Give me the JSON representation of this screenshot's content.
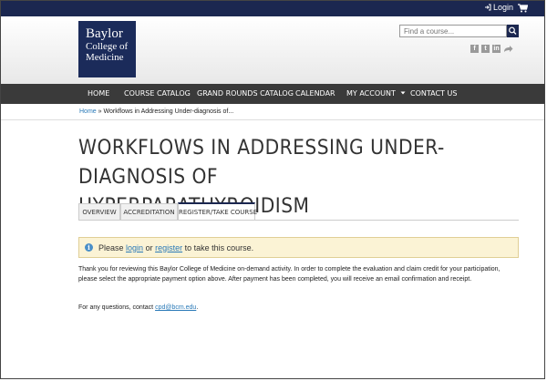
{
  "topbar": {
    "login_label": "Login",
    "login_icon": "login-arrow-icon",
    "cart_icon": "shopping-cart-icon",
    "bg_color": "#1b2750"
  },
  "header": {
    "logo": {
      "line1": "Baylor",
      "line2": "College of",
      "line3": "Medicine"
    },
    "search": {
      "placeholder": "Find a course...",
      "button_icon": "search-icon"
    },
    "social_icons": [
      "facebook-icon",
      "twitter-icon",
      "linkedin-icon",
      "share-icon"
    ]
  },
  "nav": {
    "items": [
      {
        "label": "HOME"
      },
      {
        "label": "COURSE CATALOG"
      },
      {
        "label": "GRAND ROUNDS CATALOG"
      },
      {
        "label": "CALENDAR"
      },
      {
        "label": "MY ACCOUNT"
      },
      {
        "label": "CONTACT US"
      }
    ],
    "dropdown_icon": "chevron-down-icon"
  },
  "breadcrumb": {
    "home": "Home",
    "separator": "»",
    "current": "Workflows in Addressing Under-diagnosis of..."
  },
  "page": {
    "title_line1": "WORKFLOWS IN ADDRESSING UNDER-DIAGNOSIS OF",
    "title_line2": "HYPERPARATHYROIDISM"
  },
  "tabs": [
    {
      "label": "OVERVIEW",
      "active": false
    },
    {
      "label": "ACCREDITATION",
      "active": false
    },
    {
      "label": "REGISTER/TAKE COURSE",
      "active": true
    }
  ],
  "alert": {
    "prefix": "Please",
    "login_link": "login",
    "or": "or",
    "register_link": "register",
    "suffix": "to take this course."
  },
  "body": {
    "paragraph1": "Thank you for reviewing this Baylor College of Medicine on-demand activity. In order to complete the evaluation and claim credit for your participation, please select the appropriate payment option above. After payment has been completed, you will receive an email confirmation and receipt.",
    "contact_prefix": "For any questions, contact",
    "contact_email": "cpd@bcm.edu",
    "contact_suffix": "."
  }
}
